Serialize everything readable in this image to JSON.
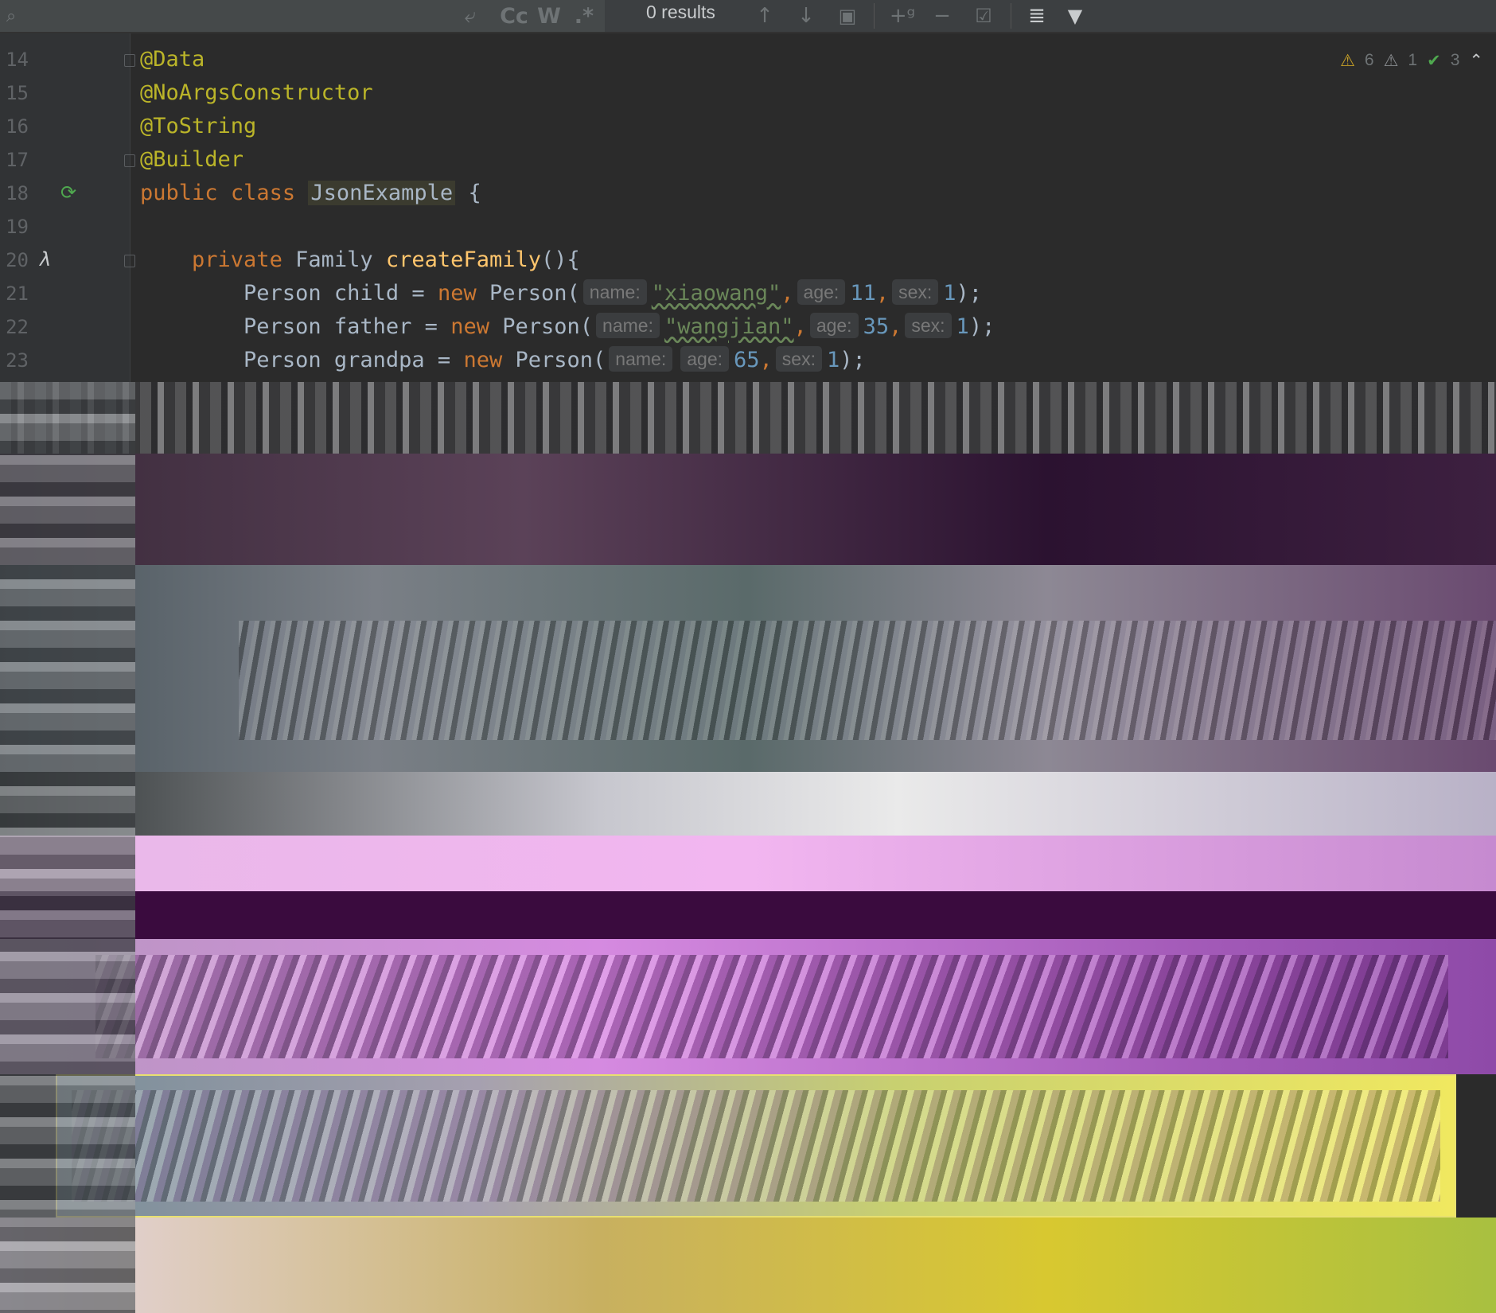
{
  "toolbar": {
    "regex_label": ".*",
    "match_case_label": "Cc",
    "words_label": "W",
    "results": "0 results"
  },
  "inspections": {
    "warnings": "6",
    "weak_warnings": "1",
    "ok": "3"
  },
  "code": {
    "lines": [
      {
        "num": "14"
      },
      {
        "num": "15"
      },
      {
        "num": "16"
      },
      {
        "num": "17"
      },
      {
        "num": "18"
      },
      {
        "num": "19"
      },
      {
        "num": "20"
      },
      {
        "num": "21"
      },
      {
        "num": "22"
      },
      {
        "num": "23"
      }
    ],
    "ann_data": "@Data",
    "ann_noargs": "@NoArgsConstructor",
    "ann_tostring": "@ToString",
    "ann_builder": "@Builder",
    "kw_public": "public",
    "kw_class": "class",
    "class_name": "JsonExample",
    "brace_open": "{",
    "kw_private": "private",
    "type_family": "Family",
    "method_name": "createFamily",
    "method_tail": "(){",
    "type_person": "Person",
    "var_child": "child",
    "var_father": "father",
    "var_grandpa": "grandpa",
    "assign": "=",
    "kw_new": "new",
    "ctor": "Person(",
    "hint_name": "name:",
    "hint_age": "age:",
    "hint_sex": "sex:",
    "str_child": "\"xiaowang\"",
    "str_father": "\"wangjian\"",
    "age_child": "11",
    "age_father": "35",
    "age_grandpa": "65",
    "sex_val": "1",
    "comma": ",",
    "close": ");"
  },
  "colors": {
    "annotation": "#bbb529",
    "keyword": "#cc7832",
    "function": "#ffc66d",
    "string": "#6a8759",
    "number": "#6897bb",
    "default": "#a9b7c6",
    "editor_bg": "#2b2b2b"
  },
  "icons": [
    "search-icon",
    "replace-icon",
    "arrow-up-icon",
    "arrow-down-icon",
    "select-all-icon",
    "add-selection-icon",
    "remove-selection-icon",
    "toggle-selection-icon",
    "filter-options-icon",
    "filter-icon",
    "warning-icon",
    "checkmark-icon",
    "collapse-icon",
    "run-icon",
    "lambda-icon"
  ]
}
